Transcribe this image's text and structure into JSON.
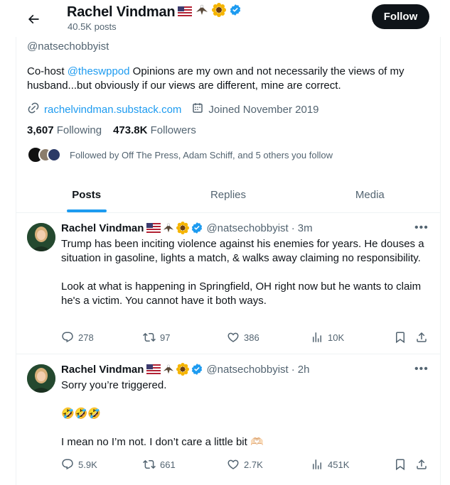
{
  "header": {
    "name": "Rachel Vindman",
    "posts_count": "40.5K posts",
    "follow_label": "Follow"
  },
  "profile": {
    "handle": "@natsechobbyist",
    "bio_prefix": "Co-host ",
    "bio_mention": "@theswppod",
    "bio_rest": " Opinions are my own and not necessarily the views of my husband...but obviously if our views are different, mine are correct.",
    "website": "rachelvindman.substack.com",
    "joined": "Joined November 2019",
    "following_count": "3,607",
    "following_label": "Following",
    "followers_count": "473.8K",
    "followers_label": "Followers",
    "followed_by": "Followed by Off The Press, Adam Schiff, and 5 others you follow"
  },
  "tabs": [
    {
      "label": "Posts",
      "active": true
    },
    {
      "label": "Replies",
      "active": false
    },
    {
      "label": "Media",
      "active": false
    }
  ],
  "tweets": [
    {
      "name": "Rachel Vindman",
      "handle": "@natsechobbyist",
      "separator": "·",
      "time": "3m",
      "paragraphs": [
        "Trump has been inciting violence against his enemies for years. He douses a situation in gasoline, lights a match, & walks away claiming no responsibility.",
        "Look at what is happening in Springfield, OH right now but he wants to claim he's a victim. You cannot have it both ways."
      ],
      "replies": "278",
      "reposts": "97",
      "likes": "386",
      "views": "10K"
    },
    {
      "name": "Rachel Vindman",
      "handle": "@natsechobbyist",
      "separator": "·",
      "time": "2h",
      "paragraphs": [
        "Sorry you’re triggered.",
        "🤣🤣🤣",
        "I mean no I’m not. I don’t care a little bit 🫶🏻"
      ],
      "replies": "5.9K",
      "reposts": "661",
      "likes": "2.7K",
      "views": "451K"
    }
  ],
  "icons": {
    "back": "arrow-left-icon",
    "verified": "verified-badge-icon",
    "link": "link-icon",
    "calendar": "calendar-icon",
    "more": "more-icon",
    "reply": "reply-icon",
    "repost": "repost-icon",
    "like": "heart-icon",
    "views": "views-icon",
    "bookmark": "bookmark-icon",
    "share": "share-icon"
  },
  "colors": {
    "accent": "#1d9bf0",
    "text": "#0f1419",
    "muted": "#536471",
    "follow_bg": "#0f1419"
  }
}
